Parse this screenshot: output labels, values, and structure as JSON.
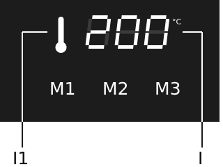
{
  "display": {
    "temperature": "200",
    "unit": "°C",
    "thermometer_icon": "thermometer-icon"
  },
  "modes": [
    {
      "label": "M1"
    },
    {
      "label": "M2"
    },
    {
      "label": "M3"
    }
  ],
  "callouts": {
    "left": "I1",
    "right": "I"
  },
  "colors": {
    "panel": "#1c1c1c",
    "segment_on": "#ffffff",
    "segment_ghost": "#3a3a3a"
  }
}
